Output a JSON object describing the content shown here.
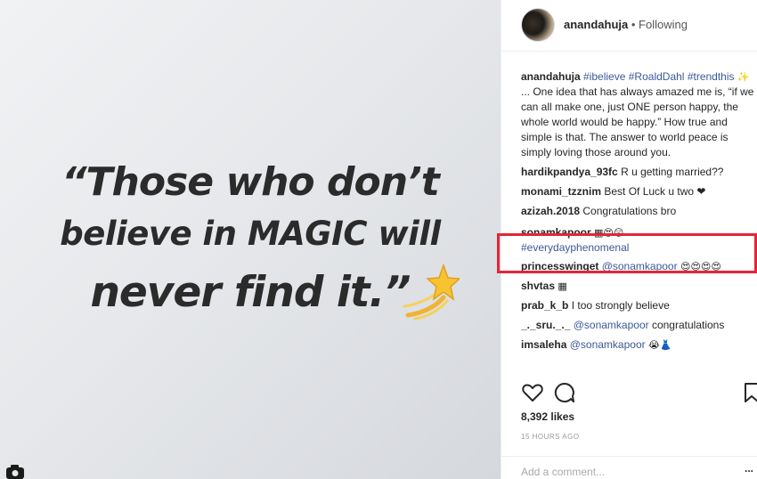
{
  "post": {
    "quote_line1": "“Those who don’t",
    "quote_line2": "believe in MAGIC will",
    "quote_line3": "never find it.”"
  },
  "header": {
    "username": "anandahuja",
    "separator": " • ",
    "follow_status": "Following"
  },
  "caption": {
    "username": "anandahuja",
    "tag1": "#ibelieve",
    "tag2": "#RoaldDahl",
    "tag3": "#trendthis",
    "sparkle": "✨",
    "text": " ... One idea that has always amazed me is, “if we can all make one, just ONE person happy, the whole world would be happy.” How true and simple is that. The answer to world peace is simply loving those around you."
  },
  "comments": [
    {
      "user": "hardikpandya_93fc",
      "text": "R u getting married??"
    },
    {
      "user": "monami_tzznim",
      "text": "Best Of Luck u two ❤"
    },
    {
      "user": "azizah.2018",
      "text": "Congratulations bro"
    },
    {
      "user": "sonamkapoor",
      "text": "▦😍😲",
      "tag": "#everydayphenomenal"
    },
    {
      "user": "princesswinget",
      "mention": "@sonamkapoor",
      "text": "😍😍😍😍"
    },
    {
      "user": "shvtas",
      "text": "▦"
    },
    {
      "user": "prab_k_b",
      "text": "I too strongly believe"
    },
    {
      "user": "_._sru._._",
      "mention": "@sonamkapoor",
      "text": "congratulations"
    },
    {
      "user": "imsaleha",
      "mention": "@sonamkapoor",
      "text": "😭👗"
    }
  ],
  "stats": {
    "likes": "8,392 likes",
    "time": "15 HOURS AGO"
  },
  "add_comment": {
    "placeholder": "Add a comment...",
    "more": "..."
  },
  "icons": {
    "like": "heart-icon",
    "comment": "comment-icon",
    "save": "bookmark-icon",
    "emoji": "shooting-star-icon",
    "corner": "camera-icon"
  },
  "colors": {
    "highlight": "#e32636",
    "link": "#3b5998"
  }
}
